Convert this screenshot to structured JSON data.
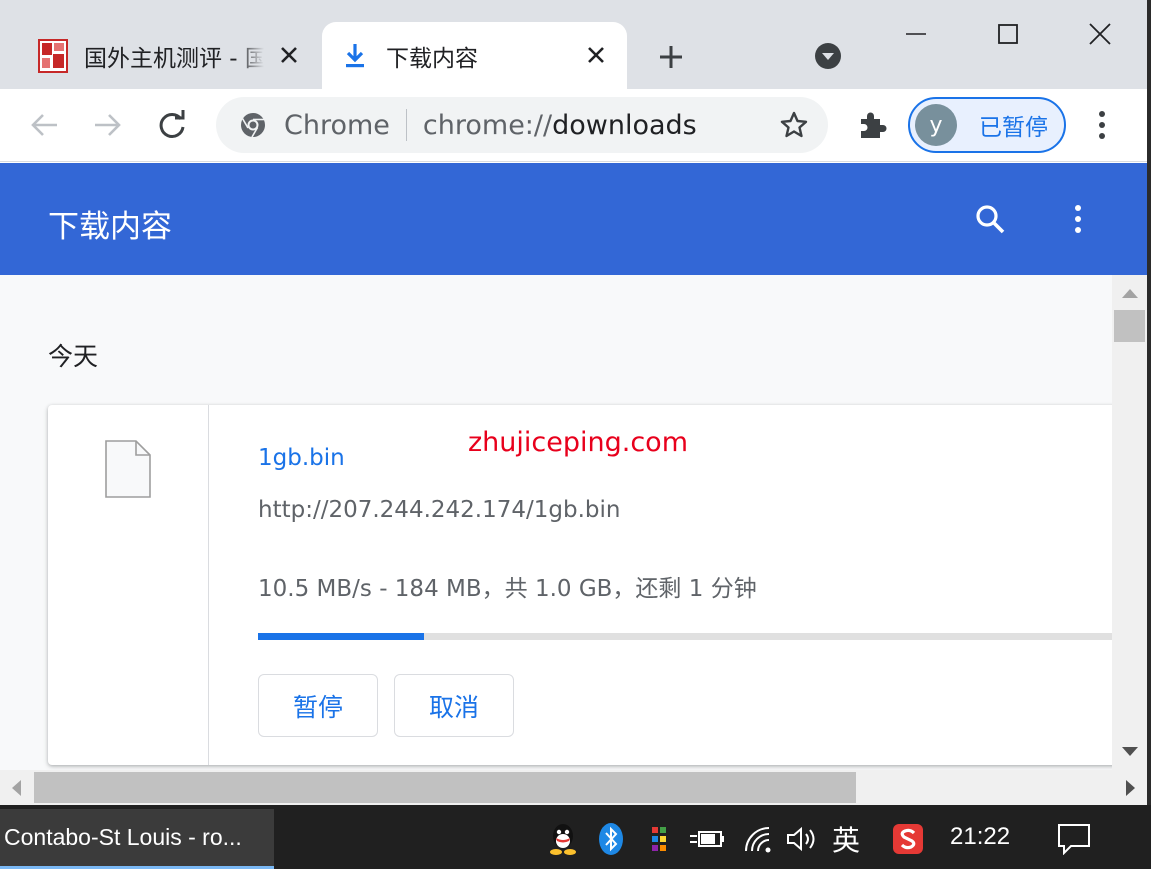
{
  "tabs": [
    {
      "title": "国外主机测评 - 国",
      "active": false
    },
    {
      "title": "下载内容",
      "active": true
    }
  ],
  "omnibox": {
    "scheme_label": "Chrome",
    "url_prefix": "chrome://",
    "url_host": "downloads"
  },
  "profile": {
    "avatar_letter": "y",
    "label": "已暂停"
  },
  "downloads": {
    "header_title": "下载内容",
    "date_label": "今天",
    "item": {
      "file_name": "1gb.bin",
      "url": "http://207.244.242.174/1gb.bin",
      "status": "10.5 MB/s - 184 MB，共 1.0 GB，还剩 1 分钟",
      "progress_fraction": 0.184,
      "pause_label": "暂停",
      "cancel_label": "取消"
    },
    "watermark": "zhujiceping.com"
  },
  "taskbar": {
    "app_label": "Contabo-St Louis - ro...",
    "ime_label": "英",
    "clock": "21:22"
  },
  "colors": {
    "header_blue": "#3367d6",
    "link_blue": "#1a73e8",
    "watermark_red": "#e8001c",
    "tabstrip_gray": "#dee1e6"
  },
  "icons": {
    "tab_favicon": "site-favicon",
    "download_tab_icon": "download-icon",
    "file_icon": "file-icon",
    "search_icon": "search-icon",
    "more_icon": "more-vert-icon"
  }
}
